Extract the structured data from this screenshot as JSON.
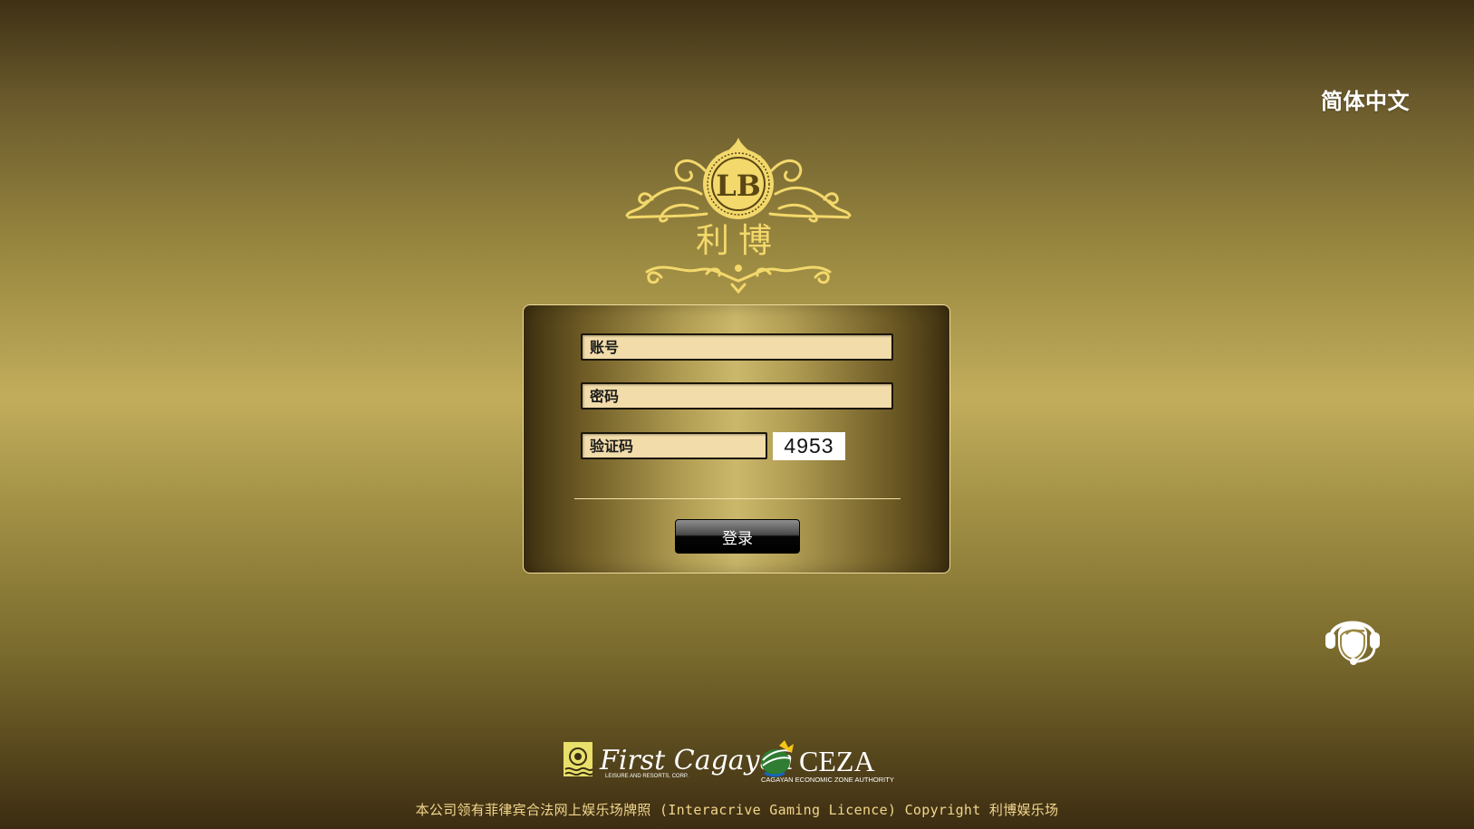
{
  "header": {
    "language": "简体中文"
  },
  "brand": {
    "monogram": "LB",
    "name": "利博"
  },
  "login_form": {
    "account_placeholder": "账号",
    "password_placeholder": "密码",
    "captcha_placeholder": "验证码",
    "captcha_code": "4953",
    "submit_label": "登录"
  },
  "partners": {
    "first_cagayan": {
      "name": "First Cagayan",
      "tagline": "LEISURE AND RESORTS, CORP."
    },
    "ceza": {
      "name": "CEZA",
      "tagline": "CAGAYAN ECONOMIC ZONE AUTHORITY"
    }
  },
  "footer": {
    "text": "本公司领有菲律宾合法网上娱乐场牌照 (Interacrive Gaming Licence) Copyright 利博娱乐场"
  },
  "icons": {
    "support": "customer-service-headset-icon"
  },
  "colors": {
    "gold_text": "#f1d68b",
    "field_bg": "#f2dcaa",
    "logo_gold": "#f3d86b"
  }
}
